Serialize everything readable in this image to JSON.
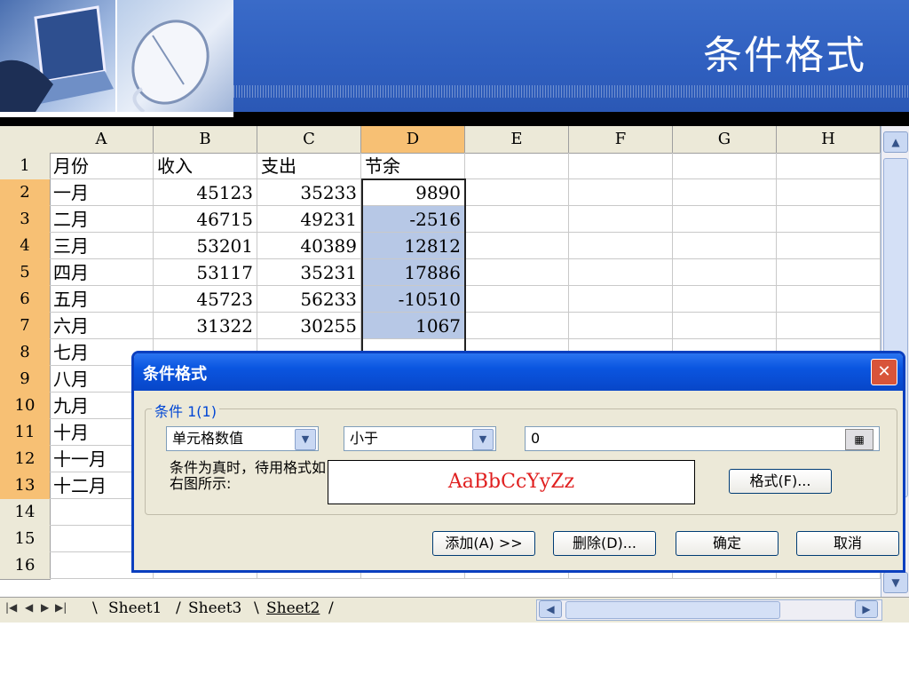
{
  "banner": {
    "title": "条件格式"
  },
  "sheet": {
    "columns": [
      "A",
      "B",
      "C",
      "D",
      "E",
      "F",
      "G",
      "H"
    ],
    "rows": [
      {
        "n": "1",
        "a": "月份",
        "b": "收入",
        "c": "支出",
        "d": "节余"
      },
      {
        "n": "2",
        "a": "一月",
        "b": "45123",
        "c": "35233",
        "d": "9890"
      },
      {
        "n": "3",
        "a": "二月",
        "b": "46715",
        "c": "49231",
        "d": "-2516"
      },
      {
        "n": "4",
        "a": "三月",
        "b": "53201",
        "c": "40389",
        "d": "12812"
      },
      {
        "n": "5",
        "a": "四月",
        "b": "53117",
        "c": "35231",
        "d": "17886"
      },
      {
        "n": "6",
        "a": "五月",
        "b": "45723",
        "c": "56233",
        "d": "-10510"
      },
      {
        "n": "7",
        "a": "六月",
        "b": "31322",
        "c": "30255",
        "d": "1067"
      },
      {
        "n": "8",
        "a": "七月"
      },
      {
        "n": "9",
        "a": "八月"
      },
      {
        "n": "10",
        "a": "九月"
      },
      {
        "n": "11",
        "a": "十月"
      },
      {
        "n": "12",
        "a": "十一月"
      },
      {
        "n": "13",
        "a": "十二月"
      },
      {
        "n": "14"
      },
      {
        "n": "15"
      },
      {
        "n": "16"
      }
    ],
    "tabs": [
      "Sheet1",
      "Sheet3",
      "Sheet2"
    ],
    "active_tab": "Sheet2"
  },
  "dialog": {
    "title": "条件格式",
    "close": "✕",
    "condition_label": "条件 1(1)",
    "type_value": "单元格数值",
    "operator_value": "小于",
    "input_value": "0",
    "hint": "条件为真时，待用格式如右图所示:",
    "preview_text": "AaBbCcYyZz",
    "buttons": {
      "format": "格式(F)...",
      "add": "添加(A) >>",
      "delete": "删除(D)...",
      "ok": "确定",
      "cancel": "取消"
    }
  },
  "colors": {
    "accent": "#0a55e0",
    "highlight": "#b7c8e6",
    "header_sel": "#f7c074",
    "preview": "#e02020"
  },
  "icons": {
    "scroll_up": "▲",
    "scroll_down": "▼",
    "scroll_left": "◀",
    "scroll_right": "▶",
    "dropdown": "▼",
    "ref": "▦"
  }
}
